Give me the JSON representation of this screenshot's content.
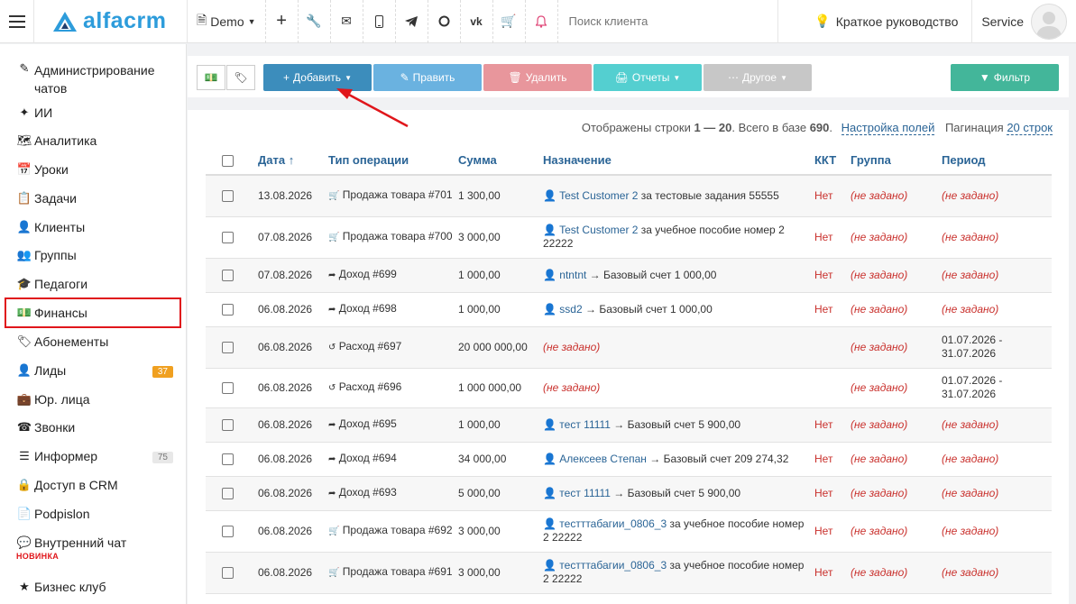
{
  "topbar": {
    "logo_text": "alfacrm",
    "demo_label": "Demo",
    "search_placeholder": "Поиск клиента",
    "guide_label": "Краткое руководство",
    "user_label": "Service",
    "icons": [
      "plus-icon",
      "wrench-icon",
      "mail-icon",
      "phone-icon",
      "telegram-icon",
      "whatsapp-icon",
      "vk-icon",
      "cart-icon",
      "bell-icon"
    ]
  },
  "sidebar": {
    "items": [
      {
        "label": "Администрирование чатов",
        "icon": "chat-admin-icon"
      },
      {
        "label": "ИИ",
        "icon": "sparkle-icon"
      },
      {
        "label": "Аналитика",
        "icon": "map-icon"
      },
      {
        "label": "Уроки",
        "icon": "calendar-icon"
      },
      {
        "label": "Задачи",
        "icon": "clipboard-icon"
      },
      {
        "label": "Клиенты",
        "icon": "user-icon"
      },
      {
        "label": "Группы",
        "icon": "users-icon"
      },
      {
        "label": "Педагоги",
        "icon": "graduation-cap-icon"
      },
      {
        "label": "Финансы",
        "icon": "money-icon"
      },
      {
        "label": "Абонементы",
        "icon": "tag-icon"
      },
      {
        "label": "Лиды",
        "icon": "user-plus-icon",
        "badge": "37"
      },
      {
        "label": "Юр. лица",
        "icon": "briefcase-icon"
      },
      {
        "label": "Звонки",
        "icon": "phone-icon"
      },
      {
        "label": "Информер",
        "icon": "list-icon",
        "badge": "75"
      },
      {
        "label": "Доступ в CRM",
        "icon": "lock-icon"
      },
      {
        "label": "Podpislon",
        "icon": "file-icon"
      },
      {
        "label": "Внутренний чат",
        "icon": "chat-icon",
        "tag": "НОВИНКА"
      },
      {
        "label": "Бизнес клуб",
        "icon": "star-icon"
      }
    ]
  },
  "toolbar": {
    "add": "Добавить",
    "edit": "Править",
    "delete": "Удалить",
    "reports": "Отчеты",
    "other": "Другое",
    "filter": "Фильтр"
  },
  "summary": {
    "prefix": "Отображены строки ",
    "range": "1 — 20",
    "mid": ". Всего в базе ",
    "total": "690",
    "dot": ".",
    "fields_link": "Настройка полей",
    "pag_label": "Пагинация",
    "pag_link": "20 строк"
  },
  "table": {
    "headers": [
      "Дата ↑",
      "Тип операции",
      "Сумма",
      "Назначение",
      "ККТ",
      "Группа",
      "Период"
    ],
    "rows": [
      {
        "date": "13.08.2026",
        "type": "Продажа товара #701",
        "type_icon": "cart-icon",
        "sum": "1 300,00",
        "purpose_link": "Test Customer 2",
        "purpose_rest": " за тестовые задания 55555",
        "kkt": "Нет",
        "group": "(не задано)",
        "period": "(не задано)"
      },
      {
        "date": "07.08.2026",
        "type": "Продажа товара #700",
        "type_icon": "cart-icon",
        "sum": "3 000,00",
        "purpose_link": "Test Customer 2",
        "purpose_rest": " за учебное пособие номер 2 22222",
        "kkt": "Нет",
        "group": "(не задано)",
        "period": "(не задано)"
      },
      {
        "date": "07.08.2026",
        "type": "Доход #699",
        "type_icon": "income-icon",
        "sum": "1 000,00",
        "purpose_link": "ntntnt",
        "purpose_rest": " → Базовый счет 1 000,00",
        "kkt": "Нет",
        "group": "(не задано)",
        "period": "(не задано)"
      },
      {
        "date": "06.08.2026",
        "type": "Доход #698",
        "type_icon": "income-icon",
        "sum": "1 000,00",
        "purpose_link": "ssd2",
        "purpose_rest": " → Базовый счет 1 000,00",
        "kkt": "Нет",
        "group": "(не задано)",
        "period": "(не задано)"
      },
      {
        "date": "06.08.2026",
        "type": "Расход #697",
        "type_icon": "expense-icon",
        "sum": "20 000 000,00",
        "purpose_link": "",
        "purpose_rest": "(не задано)",
        "kkt": "",
        "group": "(не задано)",
        "period": "01.07.2026 - 31.07.2026"
      },
      {
        "date": "06.08.2026",
        "type": "Расход #696",
        "type_icon": "expense-icon",
        "sum": "1 000 000,00",
        "purpose_link": "",
        "purpose_rest": "(не задано)",
        "kkt": "",
        "group": "(не задано)",
        "period": "01.07.2026 - 31.07.2026"
      },
      {
        "date": "06.08.2026",
        "type": "Доход #695",
        "type_icon": "income-icon",
        "sum": "1 000,00",
        "purpose_link": "тест 11111",
        "purpose_rest": " → Базовый счет 5 900,00",
        "kkt": "Нет",
        "group": "(не задано)",
        "period": "(не задано)"
      },
      {
        "date": "06.08.2026",
        "type": "Доход #694",
        "type_icon": "income-icon",
        "sum": "34 000,00",
        "purpose_link": "Алексеев Степан",
        "purpose_rest": " → Базовый счет 209 274,32",
        "kkt": "Нет",
        "group": "(не задано)",
        "period": "(не задано)"
      },
      {
        "date": "06.08.2026",
        "type": "Доход #693",
        "type_icon": "income-icon",
        "sum": "5 000,00",
        "purpose_link": "тест 11111",
        "purpose_rest": " → Базовый счет 5 900,00",
        "kkt": "Нет",
        "group": "(не задано)",
        "period": "(не задано)"
      },
      {
        "date": "06.08.2026",
        "type": "Продажа товара #692",
        "type_icon": "cart-icon",
        "sum": "3 000,00",
        "purpose_link": "тестттабагии_0806_3",
        "purpose_rest": " за учебное пособие номер 2 22222",
        "kkt": "Нет",
        "group": "(не задано)",
        "period": "(не задано)"
      },
      {
        "date": "06.08.2026",
        "type": "Продажа товара #691",
        "type_icon": "cart-icon",
        "sum": "3 000,00",
        "purpose_link": "тестттабагии_0806_3",
        "purpose_rest": " за учебное пособие номер 2 22222",
        "kkt": "Нет",
        "group": "(не задано)",
        "period": "(не задано)"
      }
    ]
  },
  "colors": {
    "accent": "#2d9cdb",
    "add": "#3c8dbc",
    "edit": "#6ab2e0",
    "delete": "#e8969c",
    "reports": "#54cfd0",
    "other": "#c7c7c7",
    "filter": "#43b69a",
    "highlight": "#e0161b",
    "lead_badge": "#f0a020"
  }
}
